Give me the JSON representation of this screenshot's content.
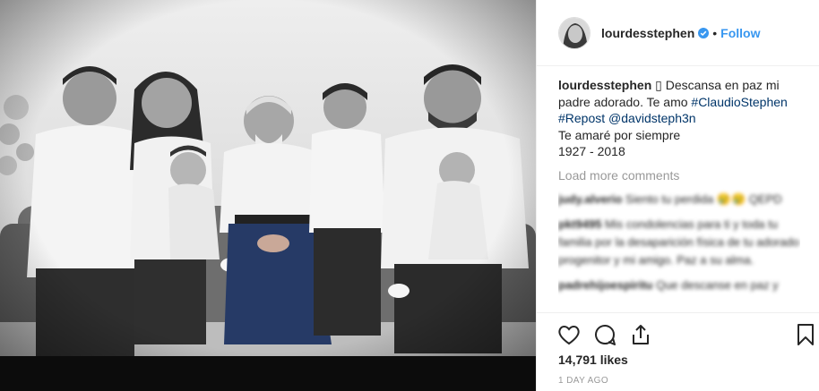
{
  "post": {
    "username": "lourdesstephen",
    "separator": "•",
    "follow_label": "Follow",
    "caption": {
      "username": "lourdesstephen",
      "symbol": "▯",
      "text_1": "Descansa en paz mi padre adorado. Te amo",
      "hashtag_1": "#ClaudioStephen",
      "hashtag_2": "#Repost",
      "mention": "@davidsteph3n",
      "line_2": "Te amaré por siempre",
      "years": "1927 - 2018"
    },
    "load_more_label": "Load more comments",
    "comments": [
      {
        "user": "judy.alverio",
        "text": "Siento tu perdida 😢😢 QEPD"
      },
      {
        "user": "pkt9495",
        "text": "Mis condolencias para ti y toda tu familia por la desaparición física de tu adorado progenitor y mi amigo. Paz a su alma."
      },
      {
        "user": "padrehijoespiritu",
        "text": "Que descanse en paz y"
      }
    ],
    "likes_label": "14,791 likes",
    "date_label": "1 DAY AGO"
  },
  "icons": {
    "like": "heart-icon",
    "comment": "comment-icon",
    "share": "share-icon",
    "save": "bookmark-icon",
    "verified": "verified-badge-icon"
  },
  "colors": {
    "accent": "#3897f0",
    "tag": "#003569",
    "muted": "#999999",
    "text": "#262626"
  }
}
